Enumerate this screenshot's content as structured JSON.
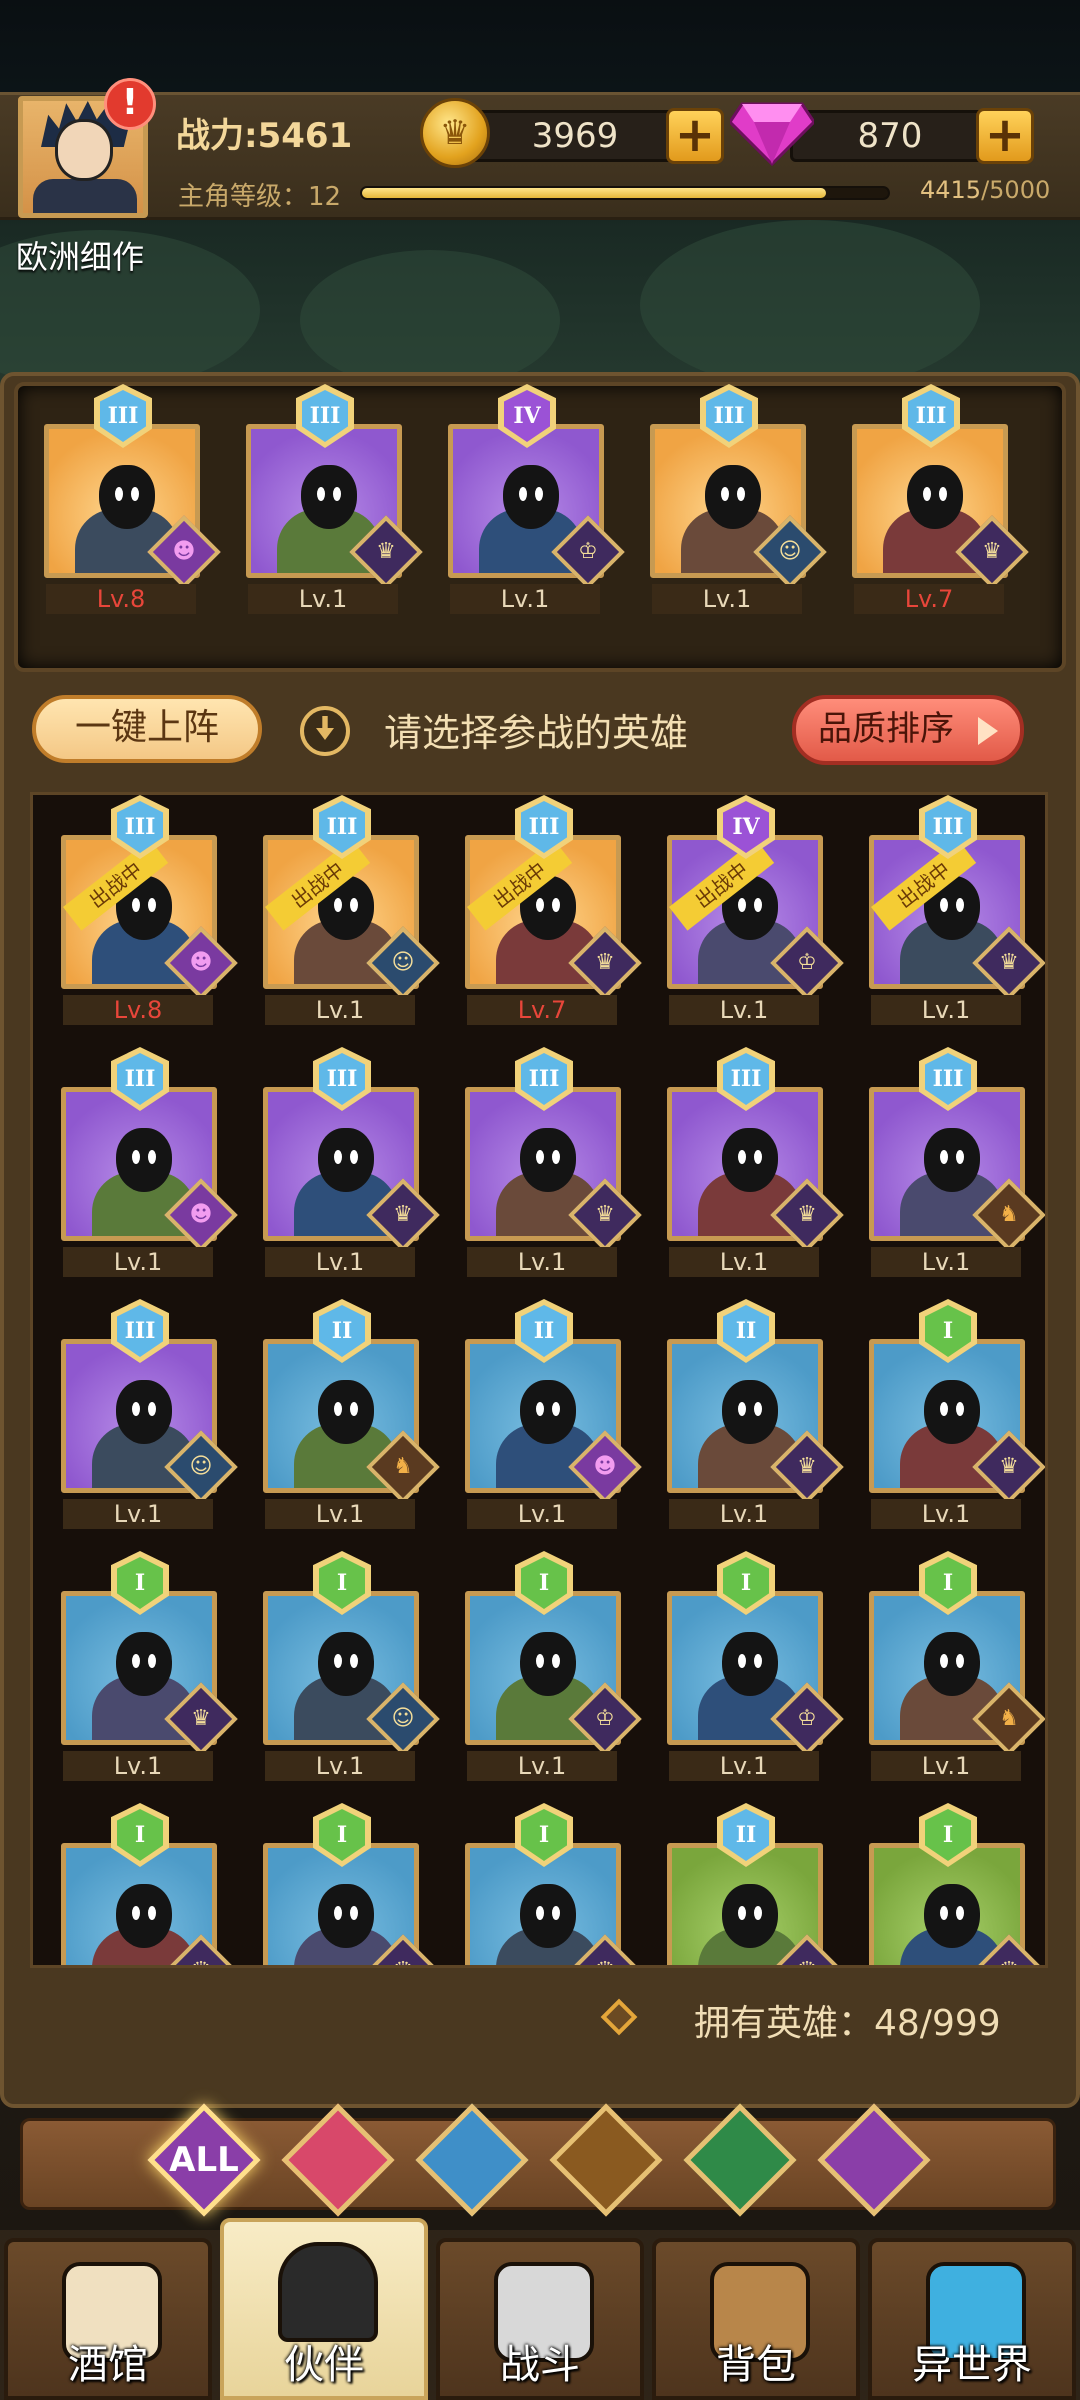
{
  "player": {
    "power_label": "战力:5461",
    "level_label": "主角等级：12",
    "xp_current": "4415",
    "xp_max": "/5000",
    "xp_fraction": 0.883,
    "username": "欧洲细作",
    "alert": "!"
  },
  "currency": {
    "gold": "3969",
    "gems": "870",
    "plus": "+"
  },
  "team": [
    {
      "tier": "III",
      "level": "Lv.8",
      "level_red": true,
      "color": "gold",
      "faction": "demon"
    },
    {
      "tier": "III",
      "level": "Lv.1",
      "level_red": false,
      "color": "purple",
      "faction": "elf"
    },
    {
      "tier": "IV",
      "level": "Lv.1",
      "level_red": false,
      "color": "purple",
      "faction": "human"
    },
    {
      "tier": "III",
      "level": "Lv.1",
      "level_red": false,
      "color": "gold",
      "faction": "fish"
    },
    {
      "tier": "III",
      "level": "Lv.7",
      "level_red": true,
      "color": "gold",
      "faction": "elf"
    }
  ],
  "actions": {
    "one_key": "一键上阵",
    "hint": "请选择参战的英雄",
    "sort": "品质排序"
  },
  "in_battle_label": "出战中",
  "heroes": [
    {
      "tier": "III",
      "level": "Lv.8",
      "level_red": true,
      "color": "gold",
      "faction": "demon",
      "in_battle": true
    },
    {
      "tier": "III",
      "level": "Lv.1",
      "level_red": false,
      "color": "gold",
      "faction": "fish",
      "in_battle": true
    },
    {
      "tier": "III",
      "level": "Lv.7",
      "level_red": true,
      "color": "gold",
      "faction": "elf",
      "in_battle": true
    },
    {
      "tier": "IV",
      "level": "Lv.1",
      "level_red": false,
      "color": "purple",
      "faction": "human",
      "in_battle": true
    },
    {
      "tier": "III",
      "level": "Lv.1",
      "level_red": false,
      "color": "purple",
      "faction": "elf",
      "in_battle": true
    },
    {
      "tier": "III",
      "level": "Lv.1",
      "level_red": false,
      "color": "purple",
      "faction": "demon",
      "in_battle": false
    },
    {
      "tier": "III",
      "level": "Lv.1",
      "level_red": false,
      "color": "purple",
      "faction": "elf",
      "in_battle": false
    },
    {
      "tier": "III",
      "level": "Lv.1",
      "level_red": false,
      "color": "purple",
      "faction": "elf",
      "in_battle": false
    },
    {
      "tier": "III",
      "level": "Lv.1",
      "level_red": false,
      "color": "purple",
      "faction": "elf",
      "in_battle": false
    },
    {
      "tier": "III",
      "level": "Lv.1",
      "level_red": false,
      "color": "purple",
      "faction": "beast",
      "in_battle": false
    },
    {
      "tier": "III",
      "level": "Lv.1",
      "level_red": false,
      "color": "purple",
      "faction": "fish",
      "in_battle": false
    },
    {
      "tier": "II",
      "level": "Lv.1",
      "level_red": false,
      "color": "blue",
      "faction": "beast",
      "in_battle": false
    },
    {
      "tier": "II",
      "level": "Lv.1",
      "level_red": false,
      "color": "blue",
      "faction": "demon",
      "in_battle": false
    },
    {
      "tier": "II",
      "level": "Lv.1",
      "level_red": false,
      "color": "blue",
      "faction": "elf",
      "in_battle": false
    },
    {
      "tier": "I",
      "level": "Lv.1",
      "level_red": false,
      "color": "blue",
      "faction": "elf",
      "in_battle": false
    },
    {
      "tier": "I",
      "level": "Lv.1",
      "level_red": false,
      "color": "blue",
      "faction": "elf",
      "in_battle": false
    },
    {
      "tier": "I",
      "level": "Lv.1",
      "level_red": false,
      "color": "blue",
      "faction": "fish",
      "in_battle": false
    },
    {
      "tier": "I",
      "level": "Lv.1",
      "level_red": false,
      "color": "blue",
      "faction": "human",
      "in_battle": false
    },
    {
      "tier": "I",
      "level": "Lv.1",
      "level_red": false,
      "color": "blue",
      "faction": "human",
      "in_battle": false
    },
    {
      "tier": "I",
      "level": "Lv.1",
      "level_red": false,
      "color": "blue",
      "faction": "beast",
      "in_battle": false
    },
    {
      "tier": "I",
      "level": "",
      "level_red": false,
      "color": "blue",
      "faction": "elf",
      "in_battle": false
    },
    {
      "tier": "I",
      "level": "",
      "level_red": false,
      "color": "blue",
      "faction": "elf",
      "in_battle": false
    },
    {
      "tier": "I",
      "level": "",
      "level_red": false,
      "color": "blue",
      "faction": "elf",
      "in_battle": false
    },
    {
      "tier": "II",
      "level": "",
      "level_red": false,
      "color": "green",
      "faction": "elf",
      "in_battle": false
    },
    {
      "tier": "I",
      "level": "",
      "level_red": false,
      "color": "green",
      "faction": "elf",
      "in_battle": false
    }
  ],
  "owned": "拥有英雄：48/999",
  "filters": [
    {
      "id": "all",
      "label": "ALL",
      "icon": "all-icon",
      "color": "#8a3ea8",
      "active": true
    },
    {
      "id": "human",
      "label": "",
      "icon": "human-faction-icon",
      "color": "#d8486a",
      "active": false
    },
    {
      "id": "fish",
      "label": "",
      "icon": "fish-faction-icon",
      "color": "#3f8fc8",
      "active": false
    },
    {
      "id": "beast",
      "label": "",
      "icon": "beast-faction-icon",
      "color": "#8a5a20",
      "active": false
    },
    {
      "id": "elf",
      "label": "",
      "icon": "elf-faction-icon",
      "color": "#2f8a48",
      "active": false
    },
    {
      "id": "demon",
      "label": "",
      "icon": "demon-faction-icon",
      "color": "#8a3ea8",
      "active": false
    }
  ],
  "nav": [
    {
      "label": "酒馆",
      "icon": "beer-mug-icon",
      "active": false
    },
    {
      "label": "伙伴",
      "icon": "partner-icon",
      "active": true
    },
    {
      "label": "战斗",
      "icon": "crossed-swords-icon",
      "active": false
    },
    {
      "label": "背包",
      "icon": "chest-icon",
      "active": false
    },
    {
      "label": "异世界",
      "icon": "portal-icon",
      "active": false
    }
  ],
  "colors": {
    "red_level": "#e8463a",
    "gold_frame": "#f0a444",
    "purple_frame": "#8f58cf",
    "blue_frame": "#4d9bc8",
    "green_frame": "#7aa63c"
  }
}
